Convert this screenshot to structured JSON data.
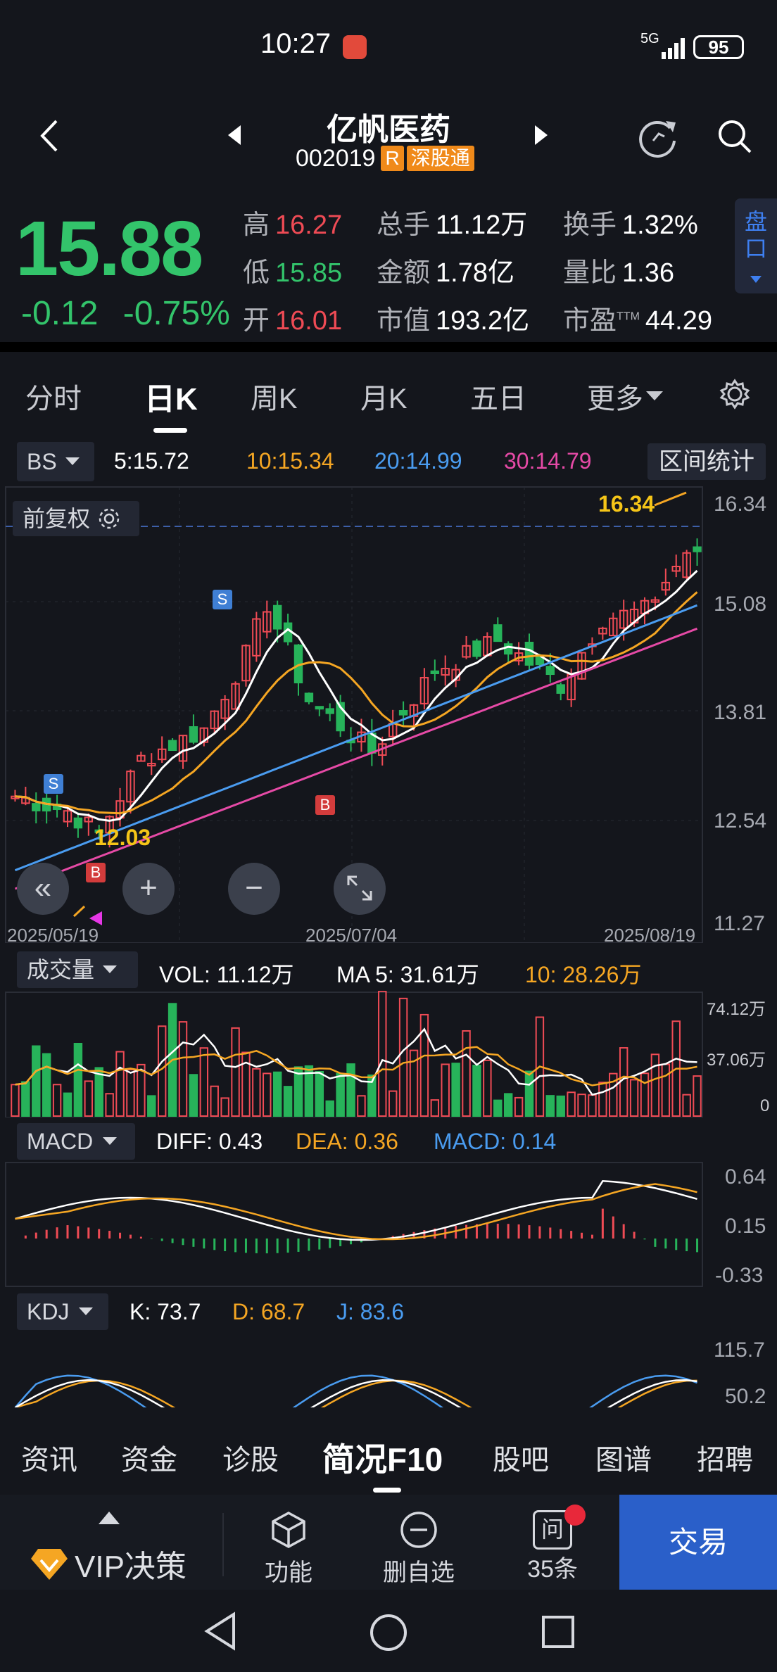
{
  "status_bar": {
    "time": "10:27",
    "network": "5G",
    "battery": "95"
  },
  "header": {
    "title": "亿帆医药",
    "code": "002019",
    "badge_r": "R",
    "badge_market": "深股通"
  },
  "quote": {
    "price": "15.88",
    "change": "-0.12",
    "change_pct": "-0.75%",
    "high_label": "高",
    "high": "16.27",
    "low_label": "低",
    "low": "15.85",
    "open_label": "开",
    "open": "16.01",
    "volume_label": "总手",
    "volume": "11.12万",
    "amount_label": "金额",
    "amount": "1.78亿",
    "mcap_label": "市值",
    "mcap": "193.2亿",
    "turnover_label": "换手",
    "turnover": "1.32%",
    "vol_ratio_label": "量比",
    "vol_ratio": "1.36",
    "pe_label": "市盈",
    "pe_sup": "TTM",
    "pe": "44.29",
    "pankou": "盘口"
  },
  "tabs": [
    "分时",
    "日K",
    "周K",
    "月K",
    "五日",
    "更多"
  ],
  "ma_bar": {
    "bs": "BS",
    "ma5": "5:15.72",
    "ma10": "10:15.34",
    "ma20": "20:14.99",
    "ma30": "30:14.79",
    "range_stats": "区间统计",
    "colors": {
      "ma5": "#ffffff",
      "ma10": "#f5a623",
      "ma20": "#4a9cf0",
      "ma30": "#e64aa6"
    }
  },
  "kline": {
    "adjust": "前复权",
    "y_ticks": [
      "16.34",
      "15.08",
      "13.81",
      "12.54",
      "11.27"
    ],
    "high_mark": "16.34",
    "low_mark": "12.03",
    "dates": [
      "2025/05/19",
      "2025/07/04",
      "2025/08/19"
    ],
    "signal_s": "S",
    "signal_b": "B"
  },
  "volume": {
    "label": "成交量",
    "vol": "VOL: 11.12万",
    "ma5": "MA 5: 31.61万",
    "ma10": "10: 28.26万",
    "y_ticks": [
      "74.12万",
      "37.06万",
      "0"
    ]
  },
  "macd": {
    "label": "MACD",
    "diff": "DIFF: 0.43",
    "dea": "DEA: 0.36",
    "macd": "MACD: 0.14",
    "y_ticks": [
      "0.64",
      "0.15",
      "-0.33"
    ]
  },
  "kdj": {
    "label": "KDJ",
    "k": "K: 73.7",
    "d": "D: 68.7",
    "j": "J: 83.6",
    "y_ticks": [
      "115.7",
      "50.2"
    ]
  },
  "bottom_tabs": [
    "资讯",
    "资金",
    "诊股",
    "简况F10",
    "股吧",
    "图谱",
    "招聘"
  ],
  "toolbar": {
    "vip": "VIP决策",
    "func": "功能",
    "remove": "删自选",
    "ask": "35条",
    "ask_icon": "问",
    "trade": "交易"
  }
}
